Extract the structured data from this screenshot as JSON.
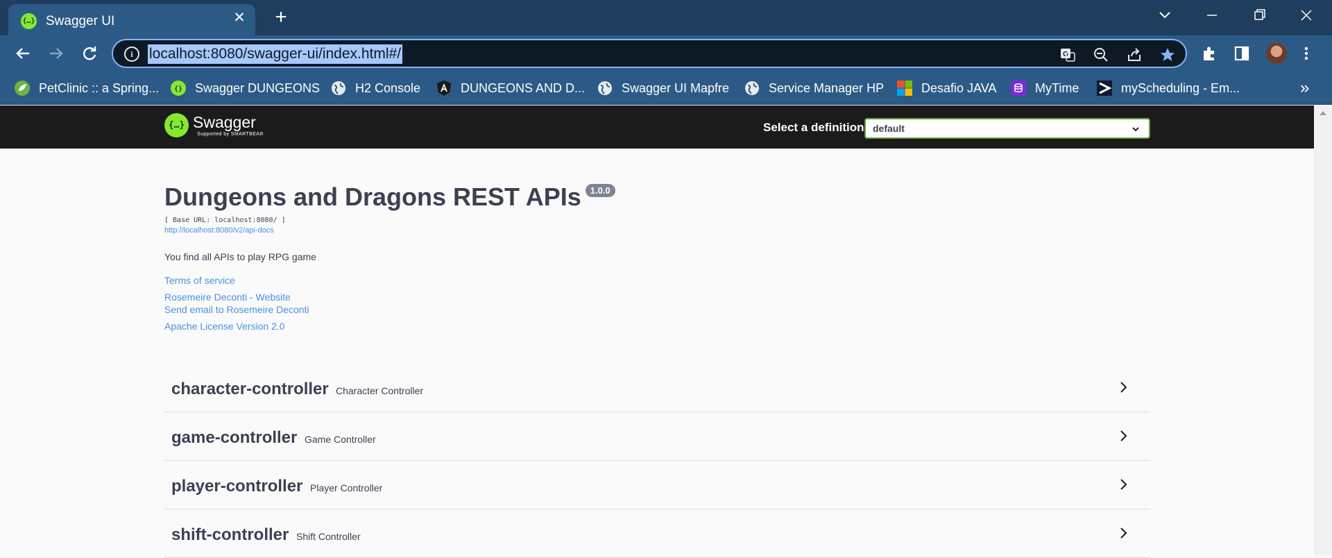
{
  "browser": {
    "tab_title": "Swagger UI",
    "address": "localhost:8080/swagger-ui/index.html#/",
    "bookmarks": [
      {
        "label": "PetClinic :: a Spring...",
        "icon": "spring-leaf-icon"
      },
      {
        "label": "Swagger DUNGEONS",
        "icon": "swagger-icon"
      },
      {
        "label": "H2 Console",
        "icon": "globe-icon"
      },
      {
        "label": "DUNGEONS AND D...",
        "icon": "angular-icon"
      },
      {
        "label": "Swagger UI Mapfre",
        "icon": "globe-icon"
      },
      {
        "label": "Service Manager HP",
        "icon": "globe-icon"
      },
      {
        "label": "Desafio JAVA",
        "icon": "microsoft-icon"
      },
      {
        "label": "MyTime",
        "icon": "database-icon"
      },
      {
        "label": "myScheduling - Em...",
        "icon": "myscheduling-icon"
      }
    ],
    "bookmarks_overflow": "»"
  },
  "swagger": {
    "logo_name": "Swagger",
    "logo_sub": "Supported by SMARTBEAR",
    "definition_label": "Select a definition",
    "definition_value": "default"
  },
  "info": {
    "title": "Dungeons and Dragons REST APIs",
    "version": "1.0.0",
    "base_url": "[ Base URL: localhost:8080/ ]",
    "docs_link": "http://localhost:8080/v2/api-docs",
    "description": "You find all APIs to play RPG game",
    "terms": "Terms of service",
    "website": "Rosemeire Deconti - Website",
    "email": "Send email to Rosemeire Deconti",
    "license": "Apache License Version 2.0"
  },
  "tags": [
    {
      "name": "character-controller",
      "description": "Character Controller"
    },
    {
      "name": "game-controller",
      "description": "Game Controller"
    },
    {
      "name": "player-controller",
      "description": "Player Controller"
    },
    {
      "name": "shift-controller",
      "description": "Shift Controller"
    }
  ],
  "colors": {
    "chrome_dark": "#1f3d5c",
    "chrome": "#2c5a86",
    "swagger_green": "#85ea2d",
    "topbar": "#1b1b1b",
    "link": "#4990e2",
    "text": "#3b4151"
  }
}
